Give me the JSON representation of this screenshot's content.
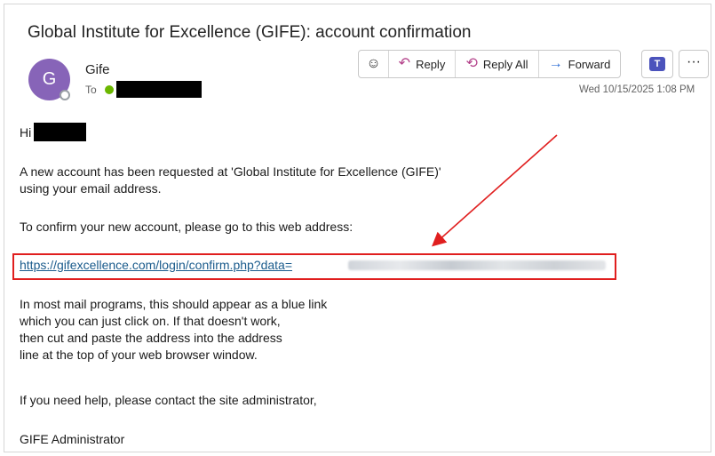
{
  "email": {
    "subject": "Global Institute for Excellence (GIFE): account confirmation",
    "sender_name": "Gife",
    "avatar_initial": "G",
    "to_label": "To",
    "timestamp": "Wed 10/15/2025 1:08 PM"
  },
  "toolbar": {
    "reply_label": "Reply",
    "reply_all_label": "Reply All",
    "forward_label": "Forward",
    "more_label": "···"
  },
  "body": {
    "greeting": "Hi",
    "para1_line1": "A new account has been requested at 'Global Institute for Excellence (GIFE)'",
    "para1_line2": "using your email address.",
    "para2": "To confirm your new account, please go to this web address:",
    "link_text": "https://gifexcellence.com/login/confirm.php?data=",
    "para3_line1": "In most mail programs, this should appear as a blue link",
    "para3_line2": "which you can just click on. If that doesn't work,",
    "para3_line3": "then cut and paste the address into the address",
    "para3_line4": "line at the top of your web browser window.",
    "para4": "If you need help, please contact the site administrator,",
    "signature": "GIFE Administrator"
  },
  "colors": {
    "avatar": "#8764b8",
    "link": "#1a5b8c",
    "highlight": "#e01e1e"
  },
  "icons": [
    "emoji-icon",
    "reply-icon",
    "reply-all-icon",
    "forward-icon",
    "teams-icon",
    "more-icon"
  ]
}
